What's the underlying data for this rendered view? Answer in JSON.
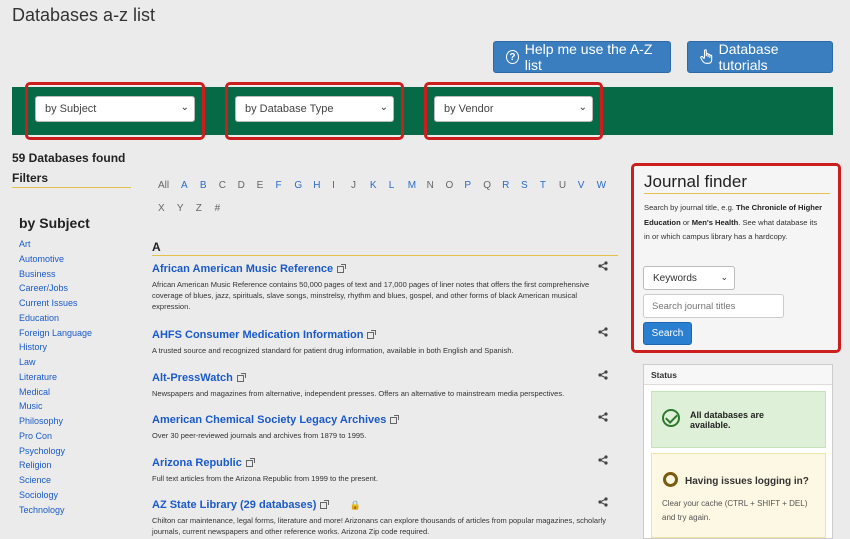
{
  "page": {
    "title": "Databases a-z list"
  },
  "header": {
    "help_button": "Help me use the A-Z list",
    "tutorials_button": "Database tutorials"
  },
  "filters_bar": {
    "subject": "by Subject",
    "type": "by Database Type",
    "vendor": "by Vendor"
  },
  "results": {
    "count_text": "59 Databases found"
  },
  "sidebar": {
    "filters_heading": "Filters",
    "subject_heading": "by Subject",
    "subjects": [
      "Art",
      "Automotive",
      "Business",
      "Career/Jobs",
      "Current Issues",
      "Education",
      "Foreign Language",
      "History",
      "Law",
      "Literature",
      "Medical",
      "Music",
      "Philosophy",
      "Pro Con",
      "Psychology",
      "Religion",
      "Science",
      "Sociology",
      "Technology"
    ]
  },
  "az": {
    "row1": [
      "All",
      "A",
      "B",
      "C",
      "D",
      "E",
      "F",
      "G",
      "H",
      "I",
      "J",
      "K",
      "L",
      "M",
      "N",
      "O",
      "P",
      "Q",
      "R",
      "S",
      "T",
      "U",
      "V",
      "W"
    ],
    "row2": [
      "X",
      "Y",
      "Z",
      "#"
    ],
    "dimmed": [
      "All",
      "C",
      "D",
      "E",
      "I",
      "J",
      "N",
      "O",
      "Q",
      "U",
      "X",
      "Y",
      "Z",
      "#"
    ]
  },
  "list": {
    "section": "A",
    "databases": [
      {
        "title": "African American Music Reference",
        "desc": "African American Music Reference contains 50,000 pages of text and 17,000 pages of liner notes that offers the first comprehensive coverage of blues, jazz, spirituals, slave songs, minstrelsy, rhythm and blues, gospel, and other forms of black American musical expression."
      },
      {
        "title": "AHFS Consumer Medication Information",
        "desc": "A trusted source and recognized standard for patient drug information, available in both English and Spanish."
      },
      {
        "title": "Alt-PressWatch",
        "desc": "Newspapers and magazines from alternative, independent presses. Offers an alternative to mainstream media perspectives."
      },
      {
        "title": "American Chemical Society Legacy Archives",
        "desc": "Over 30 peer-reviewed journals and archives from 1879 to 1995."
      },
      {
        "title": "Arizona Republic",
        "desc": "Full text articles from the Arizona Republic from 1999 to the present."
      },
      {
        "title": "AZ State Library (29 databases)",
        "desc": "Chilton car maintenance, legal forms, literature and more! Arizonans can explore thousands of articles from popular magazines, scholarly journals, current newspapers and other reference works. Arizona Zip code required."
      }
    ]
  },
  "journal_finder": {
    "title": "Journal finder",
    "desc_pre": "Search by journal title, e.g. ",
    "example1": "The Chronicle of Higher Education",
    "desc_mid": " or ",
    "example2": "Men's Health",
    "desc_post": ". See what database its in or which campus library has a hardcopy.",
    "select_value": "Keywords",
    "input_placeholder": "Search journal titles",
    "search_button": "Search"
  },
  "status": {
    "heading": "Status",
    "ok_text": "All databases are available.",
    "issue_title": "Having issues logging in?",
    "issue_text": "Clear your cache (CTRL + SHIFT + DEL) and try again."
  },
  "colors": {
    "green_bar": "#066a47",
    "button_blue": "#3a7ebf",
    "highlight_red": "#cc1e1e",
    "link_blue": "#1a5ac9"
  }
}
